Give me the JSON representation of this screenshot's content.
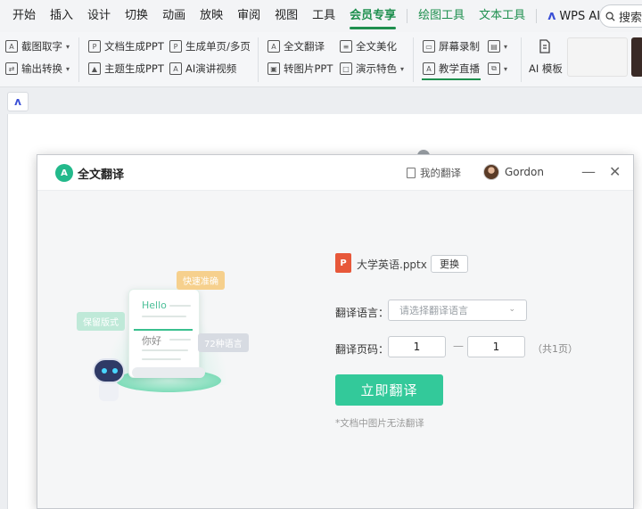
{
  "menu": {
    "items": [
      "开始",
      "插入",
      "设计",
      "切换",
      "动画",
      "放映",
      "审阅",
      "视图",
      "工具"
    ],
    "active": "会员专享",
    "green_items": [
      "绘图工具",
      "文本工具"
    ],
    "wps_ai": "WPS AI",
    "search": "搜索"
  },
  "toolbar": {
    "screenshot_text": "截图取字",
    "output_convert": "输出转换",
    "doc_to_ppt": "文档生成PPT",
    "theme_ppt": "主题生成PPT",
    "gen_single": "生成单页/多页",
    "ai_speech": "AI演讲视频",
    "full_translate": "全文翻译",
    "to_image_ppt": "转图片PPT",
    "full_beautify": "全文美化",
    "demo_features": "演示特色",
    "screen_record": "屏幕录制",
    "live_teach": "教学直播",
    "ai_template": "AI 模板"
  },
  "dialog": {
    "title": "全文翻译",
    "my_translations": "我的翻译",
    "user_name": "Gordon",
    "minimize": "—",
    "close": "✕",
    "file_name": "大学英语.pptx",
    "change_label": "更换",
    "lang_label": "翻译语言：",
    "lang_placeholder": "请选择翻译语言",
    "pages_label": "翻译页码：",
    "page_from": "1",
    "page_dash": "—",
    "page_to": "1",
    "total_pages": "（共1页）",
    "translate_button": "立即翻译",
    "note": "*文档中图片无法翻译"
  },
  "illustration": {
    "hello": "Hello",
    "nihao": "你好",
    "tag_fast": "快速准确",
    "tag_keep": "保留版式",
    "tag_langs": "72种语言"
  },
  "colors": {
    "accent_green": "#1e8f4e",
    "translate_button": "#33c99a",
    "file_icon": "#e7583a"
  }
}
